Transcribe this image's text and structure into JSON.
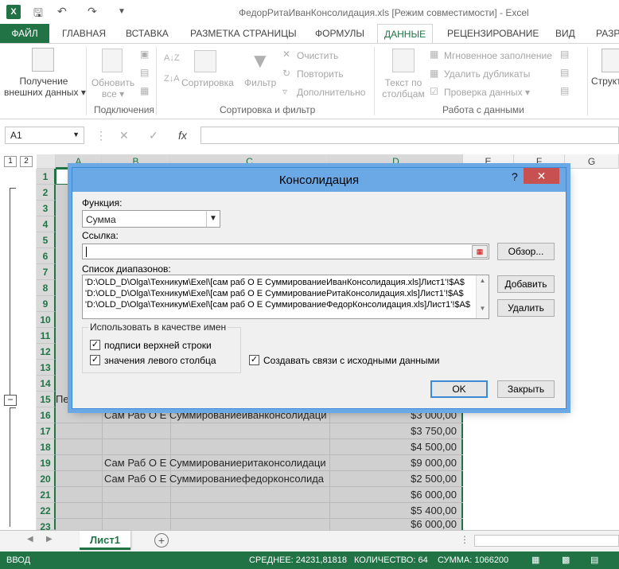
{
  "window": {
    "title": "ФедорРитаИванКонсолидация.xls  [Режим совместимости] - Excel",
    "app_icon": "X"
  },
  "ribbon_tabs": [
    "ФАЙЛ",
    "ГЛАВНАЯ",
    "ВСТАВКА",
    "РАЗМЕТКА СТРАНИЦЫ",
    "ФОРМУЛЫ",
    "ДАННЫЕ",
    "РЕЦЕНЗИРОВАНИЕ",
    "ВИД",
    "РАЗР"
  ],
  "ribbon": {
    "get_external_1": "Получение",
    "get_external_2": "внешних данных",
    "refresh_1": "Обновить",
    "refresh_2": "все",
    "connections_group": "Подключения",
    "sort": "Сортировка",
    "filter": "Фильтр",
    "clear": "Очистить",
    "reapply": "Повторить",
    "advanced": "Дополнительно",
    "sort_filter_group": "Сортировка и фильтр",
    "text_to_cols_1": "Текст по",
    "text_to_cols_2": "столбцам",
    "flash_fill": "Мгновенное заполнение",
    "remove_dup": "Удалить дубликаты",
    "validation": "Проверка данных",
    "data_tools_group": "Работа с данными",
    "outline": "Структ"
  },
  "formula_bar": {
    "name_box": "A1",
    "fx": "fx"
  },
  "columns": [
    "A",
    "B",
    "C",
    "D",
    "E",
    "F",
    "G"
  ],
  "rows": [
    "1",
    "2",
    "3",
    "4",
    "5",
    "6",
    "7",
    "8",
    "9",
    "10",
    "11",
    "12",
    "13",
    "14",
    "15",
    "16",
    "17",
    "18",
    "19",
    "20",
    "21",
    "22",
    "23"
  ],
  "outline_levels": [
    "1",
    "2"
  ],
  "cells": {
    "a15": "Пе",
    "b16": "Сам Раб О Е Суммированиеиванконсолидаци",
    "b19": "Сам Раб О Е Суммированиеритаконсолидаци",
    "b20": "Сам Раб О Е Суммированиефедорконсолида",
    "d16": "$3 000,00",
    "d17": "$3 750,00",
    "d18": "$4 500,00",
    "d19": "$9 000,00",
    "d20": "$2 500,00",
    "d21": "$6 000,00",
    "d22": "$5 400,00",
    "d23": "$6 000,00"
  },
  "sheet_tab": "Лист1",
  "status": {
    "mode": "ВВОД",
    "average": "СРЕДНЕЕ: 24231,81818",
    "count": "КОЛИЧЕСТВО: 64",
    "sum": "СУММА: 1066200"
  },
  "dialog": {
    "title": "Консолидация",
    "help": "?",
    "function_label": "Функция:",
    "function_value": "Сумма",
    "reference_label": "Ссылка:",
    "browse_button": "Обзор...",
    "ranges_label": "Список диапазонов:",
    "ranges": [
      "'D:\\OLD_D\\Olga\\Техникум\\Exel\\[сам раб О Е СуммированиеИванКонсолидация.xls]Лист1'!$A$",
      "'D:\\OLD_D\\Olga\\Техникум\\Exel\\[сам раб О Е СуммированиеРитаКонсолидация.xls]Лист1'!$A$",
      "'D:\\OLD_D\\Olga\\Техникум\\Exel\\[сам раб О Е СуммированиеФедорКонсолидация.xls]Лист1'!$A$"
    ],
    "add_button": "Добавить",
    "delete_button": "Удалить",
    "use_labels_group": "Использовать в качестве имен",
    "top_row_label": "подписи верхней строки",
    "left_col_label": "значения левого столбца",
    "create_links_label": "Создавать связи с исходными данными",
    "ok_button": "OK",
    "close_button": "Закрыть"
  }
}
